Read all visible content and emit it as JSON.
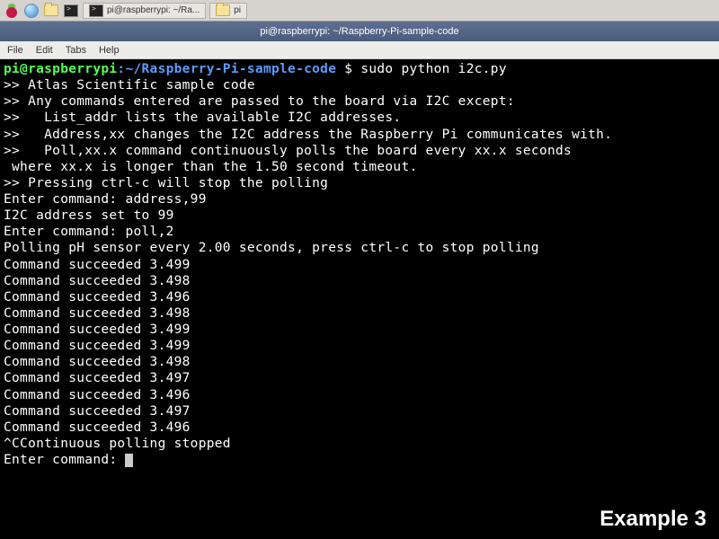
{
  "taskbar": {
    "items": [
      {
        "label": "pi@raspberrypi: ~/Ra..."
      },
      {
        "label": "pi"
      }
    ]
  },
  "window": {
    "title": "pi@raspberrypi: ~/Raspberry-Pi-sample-code"
  },
  "menubar": {
    "file": "File",
    "edit": "Edit",
    "tabs": "Tabs",
    "help": "Help"
  },
  "prompt": {
    "userhost": "pi@raspberrypi",
    "sep": ":",
    "path": "~/Raspberry-Pi-sample-code",
    "symbol": " $ ",
    "command": "sudo python i2c.py"
  },
  "output": {
    "l1": ">> Atlas Scientific sample code",
    "l2": ">> Any commands entered are passed to the board via I2C except:",
    "l3": ">>   List_addr lists the available I2C addresses.",
    "l4": ">>   Address,xx changes the I2C address the Raspberry Pi communicates with.",
    "l5": ">>   Poll,xx.x command continuously polls the board every xx.x seconds",
    "l6": " where xx.x is longer than the 1.50 second timeout.",
    "l7": ">> Pressing ctrl-c will stop the polling",
    "l8": "Enter command: address,99",
    "l9": "I2C address set to 99",
    "l10": "Enter command: poll,2",
    "l11": "Polling pH sensor every 2.00 seconds, press ctrl-c to stop polling",
    "l12": "Command succeeded 3.499",
    "l13": "Command succeeded 3.498",
    "l14": "Command succeeded 3.496",
    "l15": "Command succeeded 3.498",
    "l16": "Command succeeded 3.499",
    "l17": "Command succeeded 3.499",
    "l18": "Command succeeded 3.498",
    "l19": "Command succeeded 3.497",
    "l20": "Command succeeded 3.496",
    "l21": "Command succeeded 3.497",
    "l22": "Command succeeded 3.496",
    "l23": "^CContinuous polling stopped",
    "l24": "Enter command: "
  },
  "watermark": "Example 3"
}
